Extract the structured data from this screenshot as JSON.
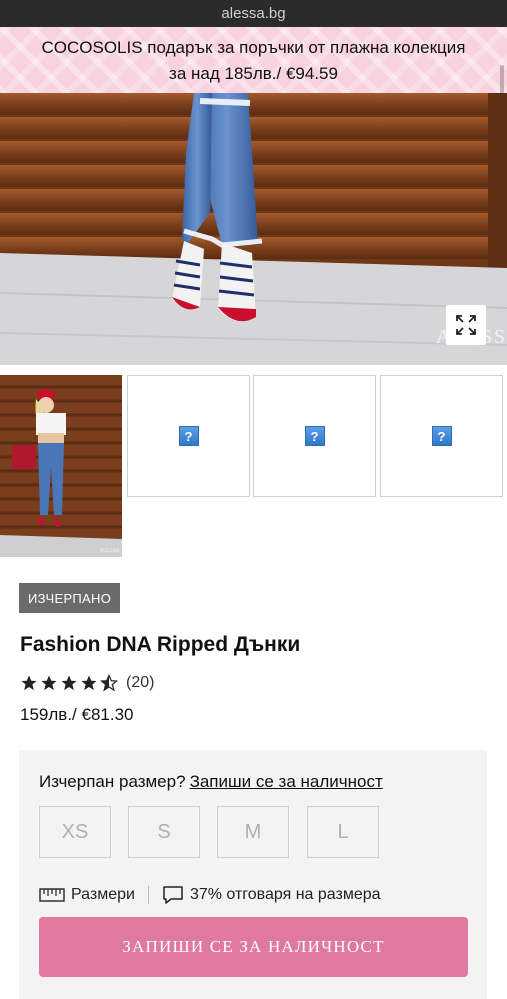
{
  "browser": {
    "url": "alessa.bg"
  },
  "promo": {
    "line1": "COCOSOLIS подарък за поръчки от плажна колекция",
    "line2": "за над 185лв./ €94.59",
    "background_color": "#f8d3df"
  },
  "gallery": {
    "hero_watermark": "ALESSA",
    "expand_icon": "expand-arrows-icon",
    "thumbnails": [
      {
        "type": "photo"
      },
      {
        "type": "placeholder",
        "icon": "broken-image-icon",
        "glyph": "?"
      },
      {
        "type": "placeholder",
        "icon": "broken-image-icon",
        "glyph": "?"
      },
      {
        "type": "placeholder",
        "icon": "broken-image-icon",
        "glyph": "?"
      }
    ]
  },
  "product": {
    "badge": "ИЗЧЕРПАНО",
    "title": "Fashion DNA Ripped Дънки",
    "rating": {
      "value": 4.5,
      "max": 5,
      "count_label": "(20)"
    },
    "price": "159лв./ €81.30"
  },
  "availability": {
    "prompt": "Изчерпан размер?",
    "link": "Запиши се за наличност",
    "sizes": [
      "XS",
      "S",
      "M",
      "L"
    ],
    "size_guide": {
      "icon": "ruler-icon",
      "label": "Размери"
    },
    "fit": {
      "icon": "speech-bubble-icon",
      "label": "37% отговаря на размера"
    },
    "cta": "ЗАПИШИ СЕ ЗА НАЛИЧНОСТ",
    "cta_color": "#e0799f"
  }
}
